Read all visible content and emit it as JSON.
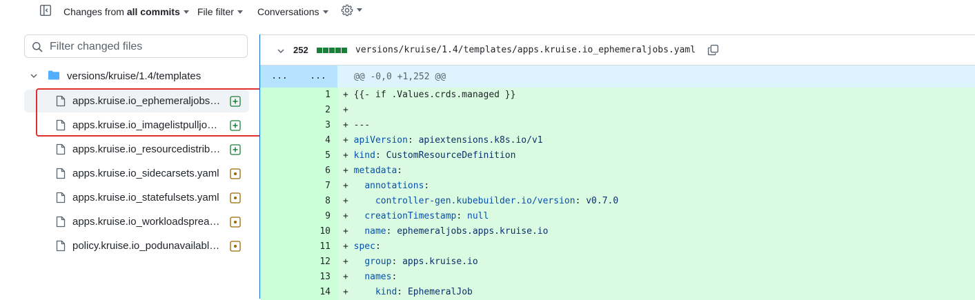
{
  "toolbar": {
    "changes_prefix": "Changes from",
    "changes_value": "all commits",
    "file_filter": "File filter",
    "conversations": "Conversations"
  },
  "sidebar": {
    "filter_placeholder": "Filter changed files",
    "folder": "versions/kruise/1.4/templates",
    "files": [
      {
        "name": "apps.kruise.io_ephemeraljobs.yaml",
        "status": "added",
        "selected": true
      },
      {
        "name": "apps.kruise.io_imagelistpulljobs.yaml",
        "status": "added",
        "selected": false
      },
      {
        "name": "apps.kruise.io_resourcedistributions.yaml",
        "status": "added",
        "selected": false
      },
      {
        "name": "apps.kruise.io_sidecarsets.yaml",
        "status": "modified",
        "selected": false
      },
      {
        "name": "apps.kruise.io_statefulsets.yaml",
        "status": "modified",
        "selected": false
      },
      {
        "name": "apps.kruise.io_workloadspreads.yaml",
        "status": "modified",
        "selected": false
      },
      {
        "name": "policy.kruise.io_podunavailablebudgets.yaml",
        "status": "modified",
        "selected": false
      }
    ]
  },
  "diff": {
    "count": "252",
    "path": "versions/kruise/1.4/templates/apps.kruise.io_ephemeraljobs.yaml",
    "hunk_dots_old": "...",
    "hunk_dots_new": "...",
    "hunk_header": "@@ -0,0 +1,252 @@",
    "lines": [
      {
        "n": "1",
        "parts": [
          [
            "c",
            "+ {{- if .Values.crds.managed }}"
          ]
        ]
      },
      {
        "n": "2",
        "parts": [
          [
            "c",
            "+"
          ]
        ]
      },
      {
        "n": "3",
        "parts": [
          [
            "c",
            "+ ---"
          ]
        ]
      },
      {
        "n": "4",
        "parts": [
          [
            "c",
            "+ "
          ],
          [
            "k",
            "apiVersion"
          ],
          [
            "c",
            ": "
          ],
          [
            "v",
            "apiextensions.k8s.io/v1"
          ]
        ]
      },
      {
        "n": "5",
        "parts": [
          [
            "c",
            "+ "
          ],
          [
            "k",
            "kind"
          ],
          [
            "c",
            ": "
          ],
          [
            "v",
            "CustomResourceDefinition"
          ]
        ]
      },
      {
        "n": "6",
        "parts": [
          [
            "c",
            "+ "
          ],
          [
            "k",
            "metadata"
          ],
          [
            "c",
            ":"
          ]
        ]
      },
      {
        "n": "7",
        "parts": [
          [
            "c",
            "+   "
          ],
          [
            "k",
            "annotations"
          ],
          [
            "c",
            ":"
          ]
        ]
      },
      {
        "n": "8",
        "parts": [
          [
            "c",
            "+     "
          ],
          [
            "k",
            "controller-gen.kubebuilder.io/version"
          ],
          [
            "c",
            ": "
          ],
          [
            "v",
            "v0.7.0"
          ]
        ]
      },
      {
        "n": "9",
        "parts": [
          [
            "c",
            "+   "
          ],
          [
            "k",
            "creationTimestamp"
          ],
          [
            "c",
            ": "
          ],
          [
            "k",
            "null"
          ]
        ]
      },
      {
        "n": "10",
        "parts": [
          [
            "c",
            "+   "
          ],
          [
            "k",
            "name"
          ],
          [
            "c",
            ": "
          ],
          [
            "v",
            "ephemeraljobs.apps.kruise.io"
          ]
        ]
      },
      {
        "n": "11",
        "parts": [
          [
            "c",
            "+ "
          ],
          [
            "k",
            "spec"
          ],
          [
            "c",
            ":"
          ]
        ]
      },
      {
        "n": "12",
        "parts": [
          [
            "c",
            "+   "
          ],
          [
            "k",
            "group"
          ],
          [
            "c",
            ": "
          ],
          [
            "v",
            "apps.kruise.io"
          ]
        ]
      },
      {
        "n": "13",
        "parts": [
          [
            "c",
            "+   "
          ],
          [
            "k",
            "names"
          ],
          [
            "c",
            ":"
          ]
        ]
      },
      {
        "n": "14",
        "parts": [
          [
            "c",
            "+     "
          ],
          [
            "k",
            "kind"
          ],
          [
            "c",
            ": "
          ],
          [
            "v",
            "EphemeralJob"
          ]
        ]
      }
    ]
  },
  "colors": {
    "added": "#1a7f37",
    "modified": "#9a6700",
    "highlight": "#e0302b",
    "accent": "#0969da"
  }
}
